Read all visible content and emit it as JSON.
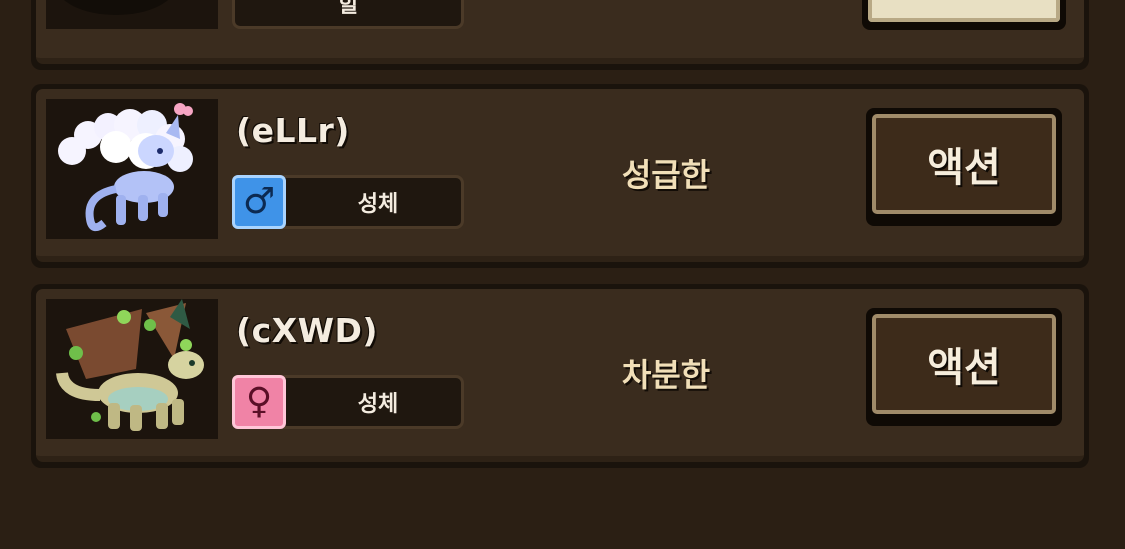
{
  "top_card": {
    "trait_label": "힐"
  },
  "cards": [
    {
      "name": "(eLLr)",
      "gender_icon": "male-symbol-icon",
      "gender_glyph": "♂",
      "trait": "성체",
      "personality": "성급한",
      "action_label": "액션"
    },
    {
      "name": "(cXWD)",
      "gender_icon": "female-symbol-icon",
      "gender_glyph": "♀",
      "trait": "성체",
      "personality": "차분한",
      "action_label": "액션"
    }
  ],
  "colors": {
    "background": "#2b1f14",
    "card_panel": "#3a2c1e",
    "male": "#3f93e8",
    "female": "#f083a6",
    "text_gold": "#f1dfb8"
  }
}
